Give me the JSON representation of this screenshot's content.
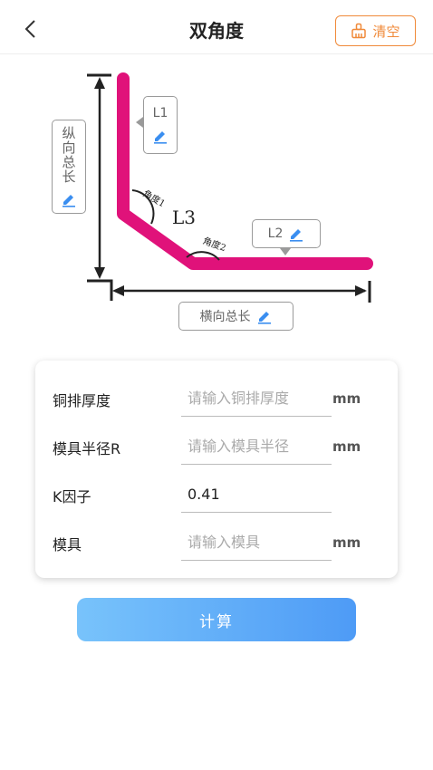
{
  "header": {
    "title": "双角度",
    "clear_label": "清空"
  },
  "diagram": {
    "l1_label": "L1",
    "l2_label": "L2",
    "l3_label": "L3",
    "angle1_label": "角度1",
    "angle2_label": "角度2",
    "vertical_total_label": "纵向总长",
    "horizontal_total_label": "横向总长"
  },
  "form": {
    "rows": [
      {
        "label": "铜排厚度",
        "placeholder": "请输入铜排厚度",
        "value": "",
        "unit": "mm"
      },
      {
        "label": "模具半径R",
        "placeholder": "请输入模具半径",
        "value": "",
        "unit": "mm"
      },
      {
        "label": "K因子",
        "placeholder": "",
        "value": "0.41",
        "unit": ""
      },
      {
        "label": "模具",
        "placeholder": "请输入模具",
        "value": "",
        "unit": "mm"
      }
    ]
  },
  "calculate_label": "计算",
  "colors": {
    "accent_orange": "#f08a3a",
    "busbar_magenta": "#e0127a",
    "button_blue_start": "#78c3fb",
    "button_blue_end": "#4e9bf6",
    "pen_blue": "#3a8ef0"
  }
}
